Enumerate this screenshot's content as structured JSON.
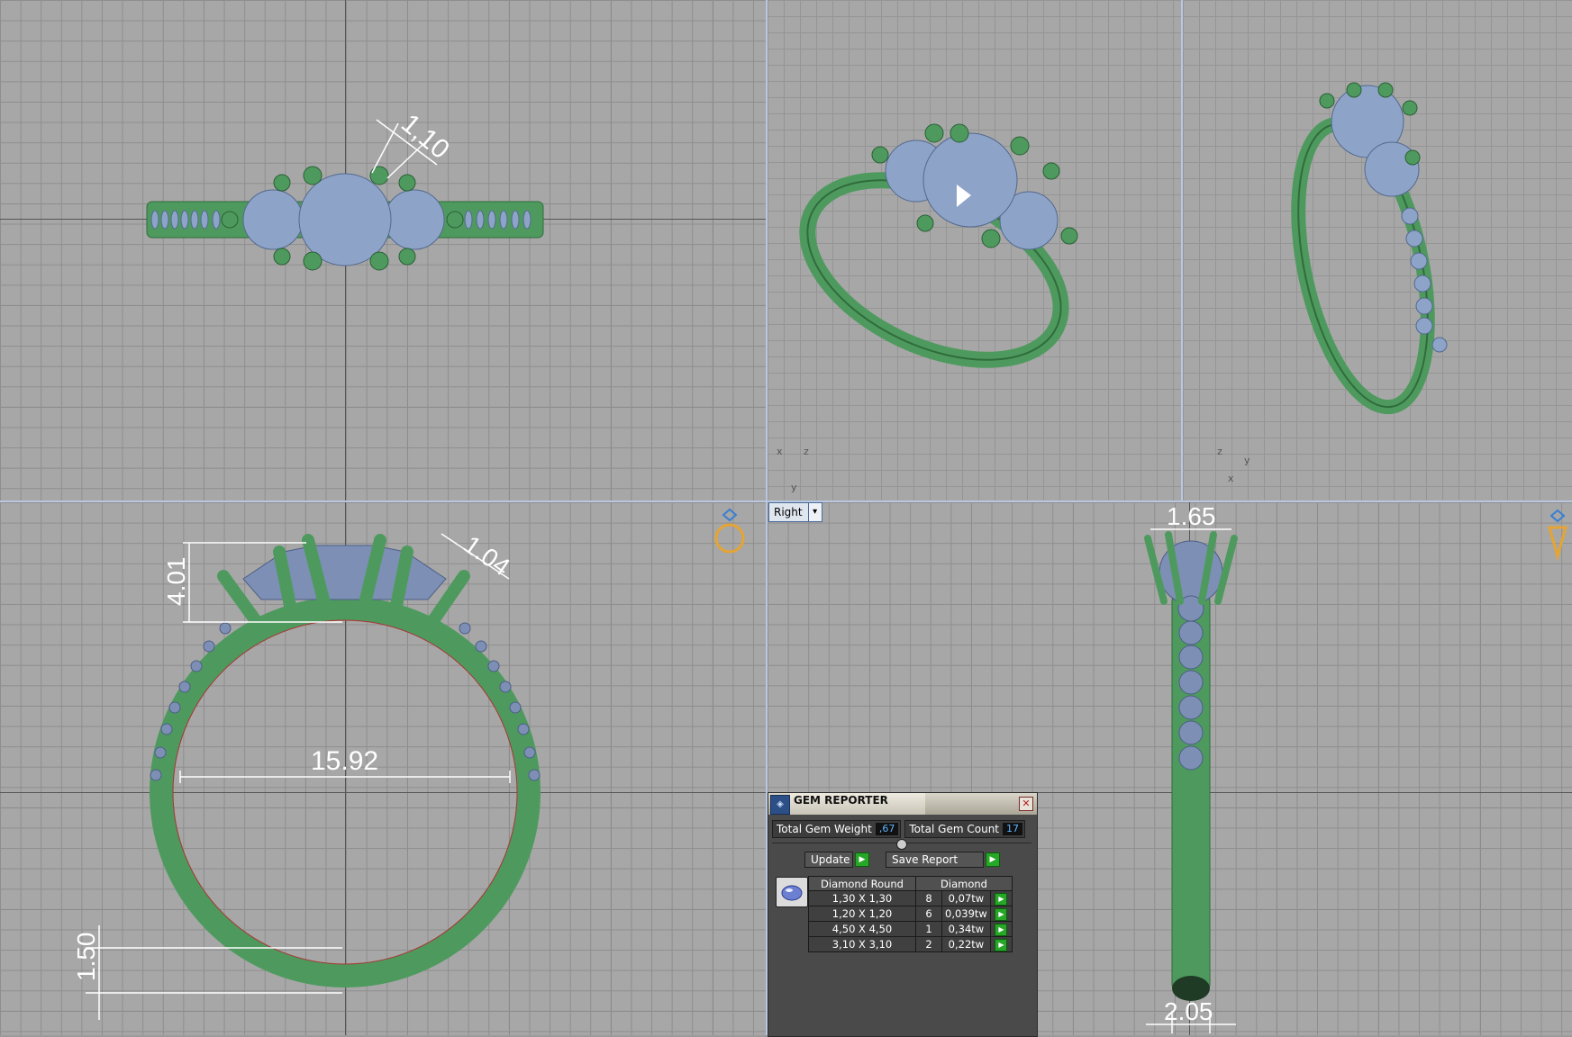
{
  "viewports": {
    "top": {
      "dimension": "1,10"
    },
    "front": {
      "dimensions": {
        "height": "4.01",
        "prong": "1.04",
        "inner_diameter": "15.92",
        "band": "1.50"
      }
    },
    "right": {
      "dropdown_label": "Right",
      "dimensions": {
        "top_width": "1.65",
        "bottom_width": "2.05"
      }
    },
    "perspective_axes": [
      "x",
      "y",
      "z"
    ]
  },
  "gem_reporter": {
    "title": "GEM REPORTER",
    "total_weight_label": "Total Gem Weight",
    "total_weight_value": ",67",
    "total_count_label": "Total Gem Count",
    "total_count_value": "17",
    "update_label": "Update",
    "save_label": "Save Report",
    "table": {
      "headers": [
        "Diamond Round",
        "",
        "Diamond"
      ],
      "rows": [
        {
          "size": "1,30 X 1,30",
          "count": "8",
          "weight": "0,07tw"
        },
        {
          "size": "1,20 X 1,20",
          "count": "6",
          "weight": "0,039tw"
        },
        {
          "size": "4,50 X 4,50",
          "count": "1",
          "weight": "0,34tw"
        },
        {
          "size": "3,10 X 3,10",
          "count": "2",
          "weight": "0,22tw"
        }
      ]
    }
  },
  "colors": {
    "metal": "#5a9f6a",
    "gem": "#8ea3c8",
    "accent": "#3b8bd9"
  }
}
